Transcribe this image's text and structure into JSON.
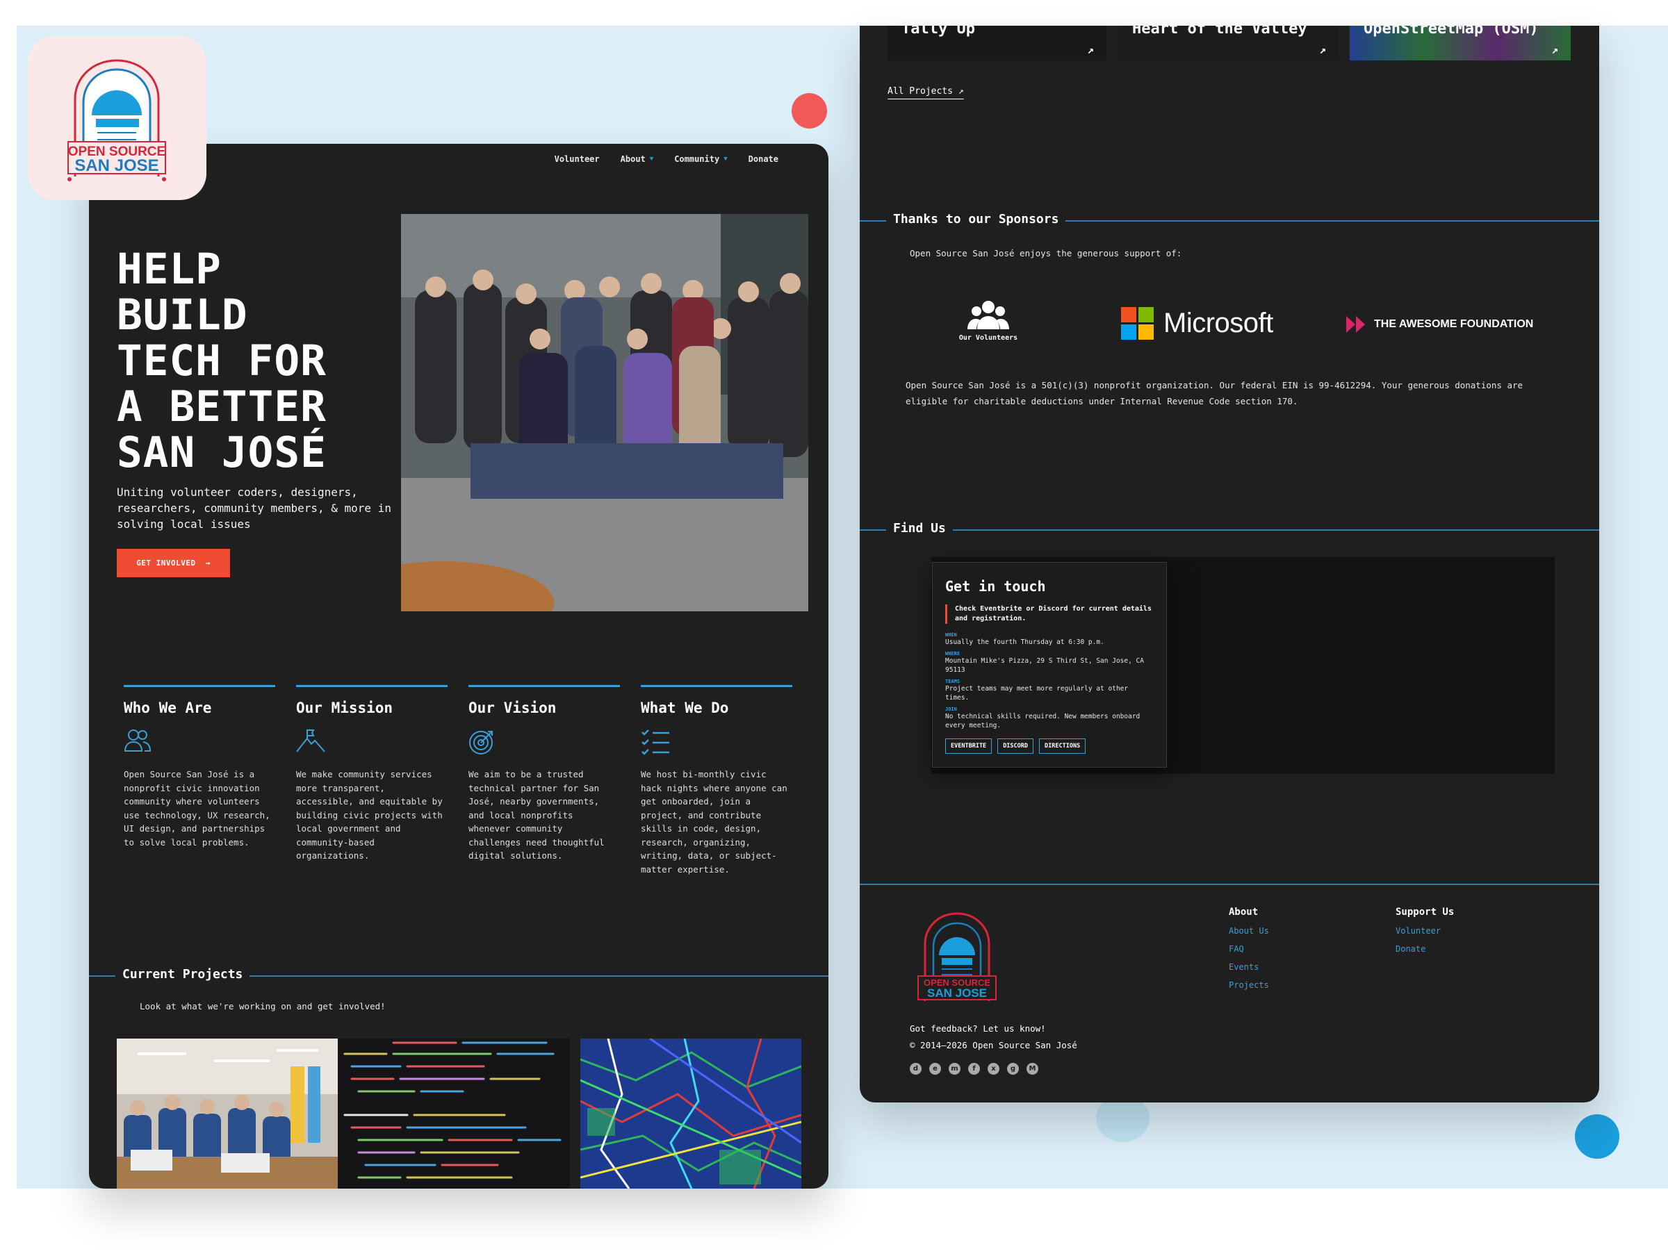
{
  "brand": {
    "line1": "OPEN SOURCE",
    "line2": "SAN JOSE"
  },
  "nav": {
    "volunteer": "Volunteer",
    "about": "About",
    "community": "Community",
    "donate": "Donate"
  },
  "hero": {
    "title_lines": [
      "HELP",
      "BUILD",
      "TECH FOR",
      "A BETTER",
      "SAN JOSÉ"
    ],
    "subtitle": "Uniting volunteer coders, designers, researchers, community members, & more in solving local issues",
    "cta": "GET INVOLVED",
    "cta_arrow": "→"
  },
  "features": [
    {
      "title": "Who We Are",
      "icon": "people-icon",
      "text": "Open Source San José is a nonprofit civic innovation community where volunteers use technology, UX research, UI design, and partnerships to solve local problems."
    },
    {
      "title": "Our Mission",
      "icon": "mountain-flag-icon",
      "text": "We make community services more transparent, accessible, and equitable by building civic projects with local government and community-based organizations."
    },
    {
      "title": "Our Vision",
      "icon": "target-icon",
      "text": "We aim to be a trusted technical partner for San José, nearby governments, and local nonprofits whenever community challenges need thoughtful digital solutions."
    },
    {
      "title": "What We Do",
      "icon": "checklist-icon",
      "text": "We host bi-monthly civic hack nights where anyone can get onboarded, join a project, and contribute skills in code, design, research, organizing, writing, data, or subject-matter expertise."
    }
  ],
  "current_projects": {
    "heading": "Current Projects",
    "intro": "Look at what we're working on and get involved!"
  },
  "projects_top": [
    {
      "title": "Tally Up",
      "arrow": "↗"
    },
    {
      "title": "Heart of the Valley",
      "arrow": "↗"
    },
    {
      "title": "OpenStreetMap (OSM)",
      "arrow": "↗"
    }
  ],
  "all_projects": "All Projects ↗",
  "sponsors": {
    "heading": "Thanks to our Sponsors",
    "intro": "Open Source San José enjoys the generous support of:",
    "volunteers_label": "Our Volunteers",
    "microsoft": "Microsoft",
    "awesome": "THE AWESOME FOUNDATION",
    "ein_text": "Open Source San José is a 501(c)(3) nonprofit organization. Our federal EIN is 99-4612294. Your generous donations are eligible for charitable deductions under Internal Revenue Code section 170."
  },
  "find_us": {
    "heading": "Find Us",
    "card_title": "Get in touch",
    "note": "Check Eventbrite or Discord for current details and registration.",
    "when_label": "WHEN",
    "when": "Usually the fourth Thursday at 6:30 p.m.",
    "where_label": "WHERE",
    "where": "Mountain Mike's Pizza, 29 S Third St, San Jose, CA 95113",
    "teams_label": "TEAMS",
    "teams": "Project teams may meet more regularly at other times.",
    "join_label": "JOIN",
    "join": "No technical skills required. New members onboard every meeting.",
    "buttons": [
      "EVENTBRITE",
      "DISCORD",
      "DIRECTIONS"
    ]
  },
  "footer": {
    "about_heading": "About",
    "about_links": [
      "About Us",
      "FAQ",
      "Events",
      "Projects"
    ],
    "support_heading": "Support Us",
    "support_links": [
      "Volunteer",
      "Donate"
    ],
    "feedback": "Got feedback? Let us know!",
    "copyright": "© 2014–2026 Open Source San José",
    "social": [
      "discord-icon",
      "eventbrite-icon",
      "mastodon-icon",
      "facebook-icon",
      "x-icon",
      "github-icon",
      "meetup-icon"
    ]
  },
  "colors": {
    "accent": "#3aa0d8",
    "cta": "#ef4c33",
    "bg": "#1f1f20",
    "backdrop": "#dceef7"
  }
}
